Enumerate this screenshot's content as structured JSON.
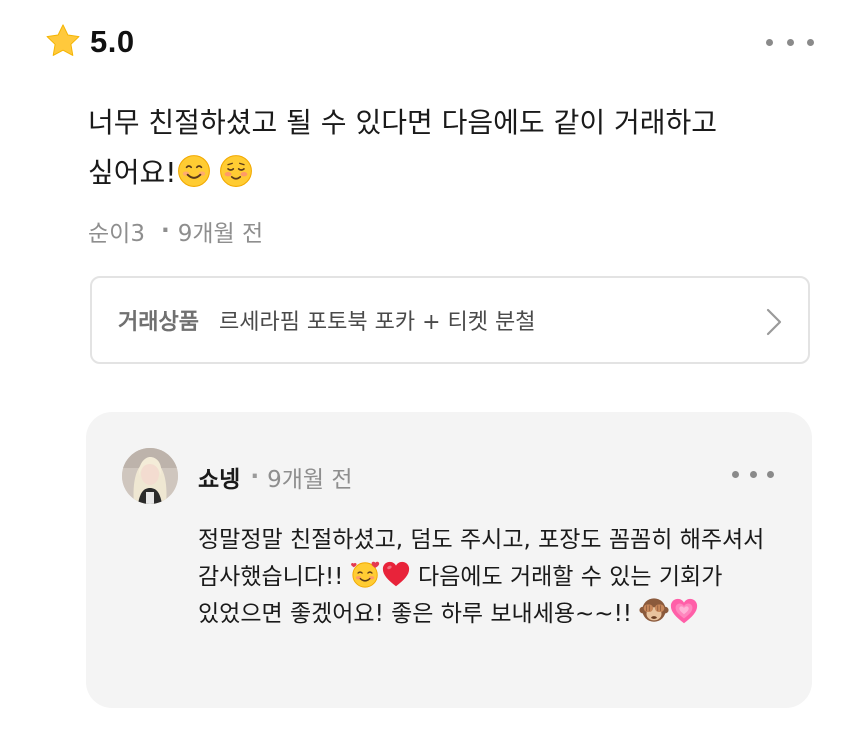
{
  "rating": {
    "icon": "star-icon",
    "value": "5.0",
    "star_color": "#FFC93C"
  },
  "review": {
    "text": "너무 친절하셨고 될 수 있다면 다음에도 같이 거래하고 싶어요!",
    "emojis": [
      "smiling-face-icon",
      "relieved-face-icon"
    ],
    "author": "순이3",
    "separator": "·",
    "time": "9개월 전"
  },
  "product": {
    "label": "거래상품",
    "name": "르세라핌 포토북 포카 + 티켓 분철"
  },
  "reply": {
    "author": "쇼넹",
    "separator": "·",
    "time": "9개월 전",
    "text_part1": "정말정말 친절하셨고, 덤도 주시고, 포장도 꼼꼼히 해주셔서 감사했습니다!! ",
    "text_part2": " 다음에도 거래할 수 있는 기회가 있었으면 좋겠어요! 좋은 하루 보내세용~~!! ",
    "emojis": [
      "smiling-face-with-hearts-icon",
      "red-heart-icon",
      "see-no-evil-monkey-icon",
      "growing-heart-icon"
    ]
  }
}
